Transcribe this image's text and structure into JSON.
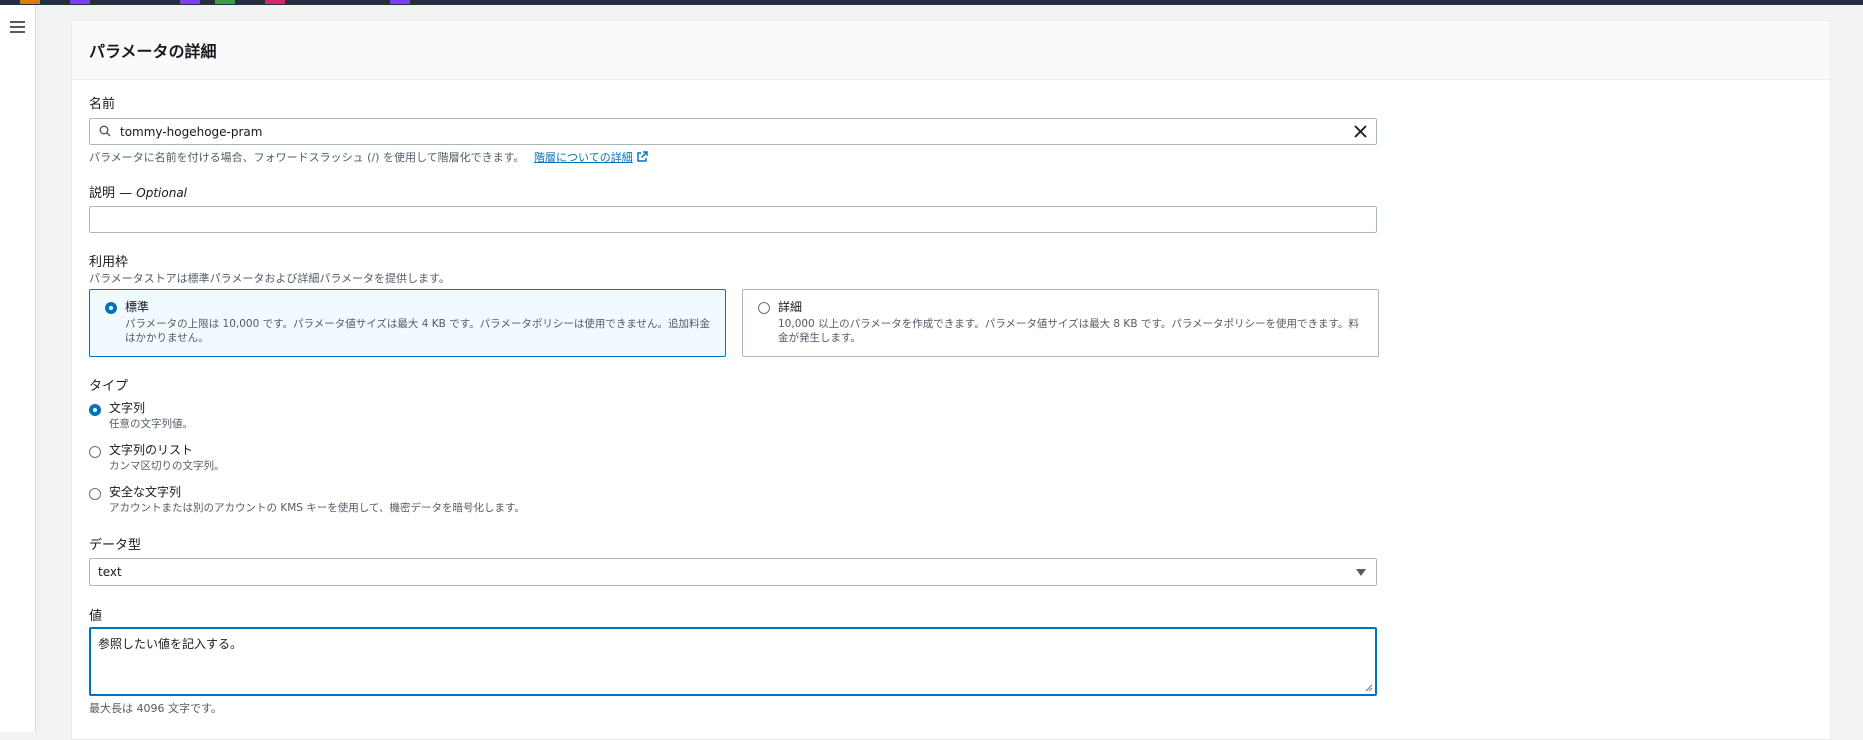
{
  "colors": {
    "accent": "#0073bb",
    "border": "#aab7b8",
    "header_bg": "#232f3e"
  },
  "panel": {
    "title": "パラメータの詳細"
  },
  "name": {
    "label": "名前",
    "value": "tommy-hogehoge-pram",
    "hint": "パラメータに名前を付ける場合、フォワードスラッシュ (/) を使用して階層化できます。",
    "link": "階層についての詳細"
  },
  "description": {
    "label": "説明 —",
    "optional": "Optional",
    "value": ""
  },
  "tier": {
    "label": "利用枠",
    "hint": "パラメータストアは標準パラメータおよび詳細パラメータを提供します。",
    "options": [
      {
        "title": "標準",
        "desc": "パラメータの上限は 10,000 です。パラメータ値サイズは最大 4 KB です。パラメータポリシーは使用できません。追加料金はかかりません。",
        "selected": true
      },
      {
        "title": "詳細",
        "desc": "10,000 以上のパラメータを作成できます。パラメータ値サイズは最大 8 KB です。パラメータポリシーを使用できます。料金が発生します。",
        "selected": false
      }
    ]
  },
  "type": {
    "label": "タイプ",
    "options": [
      {
        "title": "文字列",
        "desc": "任意の文字列値。",
        "selected": true
      },
      {
        "title": "文字列のリスト",
        "desc": "カンマ区切りの文字列。",
        "selected": false
      },
      {
        "title": "安全な文字列",
        "desc": "アカウントまたは別のアカウントの KMS キーを使用して、機密データを暗号化します。",
        "selected": false
      }
    ]
  },
  "datatype": {
    "label": "データ型",
    "value": "text"
  },
  "value": {
    "label": "値",
    "text": "参照したい値を記入する。",
    "hint": "最大長は 4096 文字です。"
  }
}
